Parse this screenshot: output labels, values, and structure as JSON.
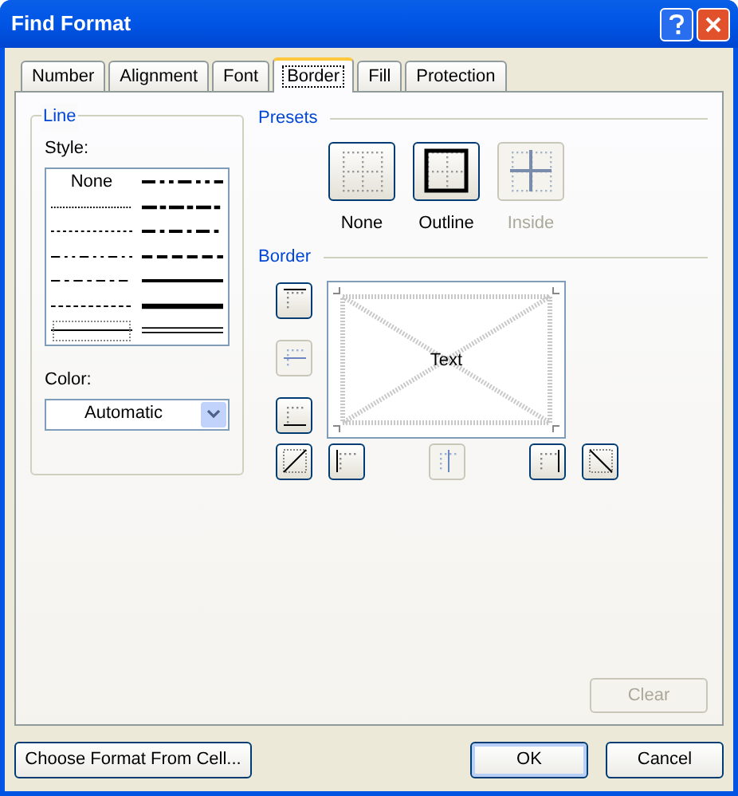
{
  "window": {
    "title": "Find Format"
  },
  "tabs": [
    {
      "label": "Number",
      "selected": false
    },
    {
      "label": "Alignment",
      "selected": false
    },
    {
      "label": "Font",
      "selected": false
    },
    {
      "label": "Border",
      "selected": true
    },
    {
      "label": "Fill",
      "selected": false
    },
    {
      "label": "Protection",
      "selected": false
    }
  ],
  "line": {
    "title": "Line",
    "style_label": "Style:",
    "styles": [
      {
        "kind": "none",
        "label": "None",
        "selected": false
      },
      {
        "kind": "medium-dash-dot-dot",
        "selected": false
      },
      {
        "kind": "hair",
        "selected": false
      },
      {
        "kind": "slant-dash-dot",
        "selected": false
      },
      {
        "kind": "dotted",
        "selected": false
      },
      {
        "kind": "medium-dash-dot",
        "selected": false
      },
      {
        "kind": "dash-dot-dot",
        "selected": false
      },
      {
        "kind": "medium-dashed",
        "selected": false
      },
      {
        "kind": "dash-dot",
        "selected": false
      },
      {
        "kind": "medium",
        "selected": false
      },
      {
        "kind": "dashed",
        "selected": false
      },
      {
        "kind": "thick",
        "selected": false
      },
      {
        "kind": "thin",
        "selected": true
      },
      {
        "kind": "double",
        "selected": false
      }
    ],
    "color_label": "Color:",
    "color_value": "Automatic"
  },
  "presets": {
    "title": "Presets",
    "items": [
      {
        "kind": "none",
        "label": "None",
        "disabled": false
      },
      {
        "kind": "outline",
        "label": "Outline",
        "disabled": false
      },
      {
        "kind": "inside",
        "label": "Inside",
        "disabled": true
      }
    ]
  },
  "border": {
    "title": "Border",
    "preview_text": "Text",
    "buttons": [
      {
        "kind": "top",
        "disabled": false
      },
      {
        "kind": "middle-horizontal",
        "disabled": true
      },
      {
        "kind": "bottom",
        "disabled": false
      },
      {
        "kind": "diagonal-up",
        "disabled": false
      },
      {
        "kind": "left",
        "disabled": false
      },
      {
        "kind": "middle-vertical",
        "disabled": true
      },
      {
        "kind": "right",
        "disabled": false
      },
      {
        "kind": "diagonal-down",
        "disabled": false
      }
    ]
  },
  "clear_button": {
    "label": "Clear",
    "disabled": true
  },
  "footer_buttons": [
    {
      "label": "Choose Format From Cell..."
    },
    {
      "label": "OK",
      "default": true
    },
    {
      "label": "Cancel",
      "default": false
    }
  ]
}
